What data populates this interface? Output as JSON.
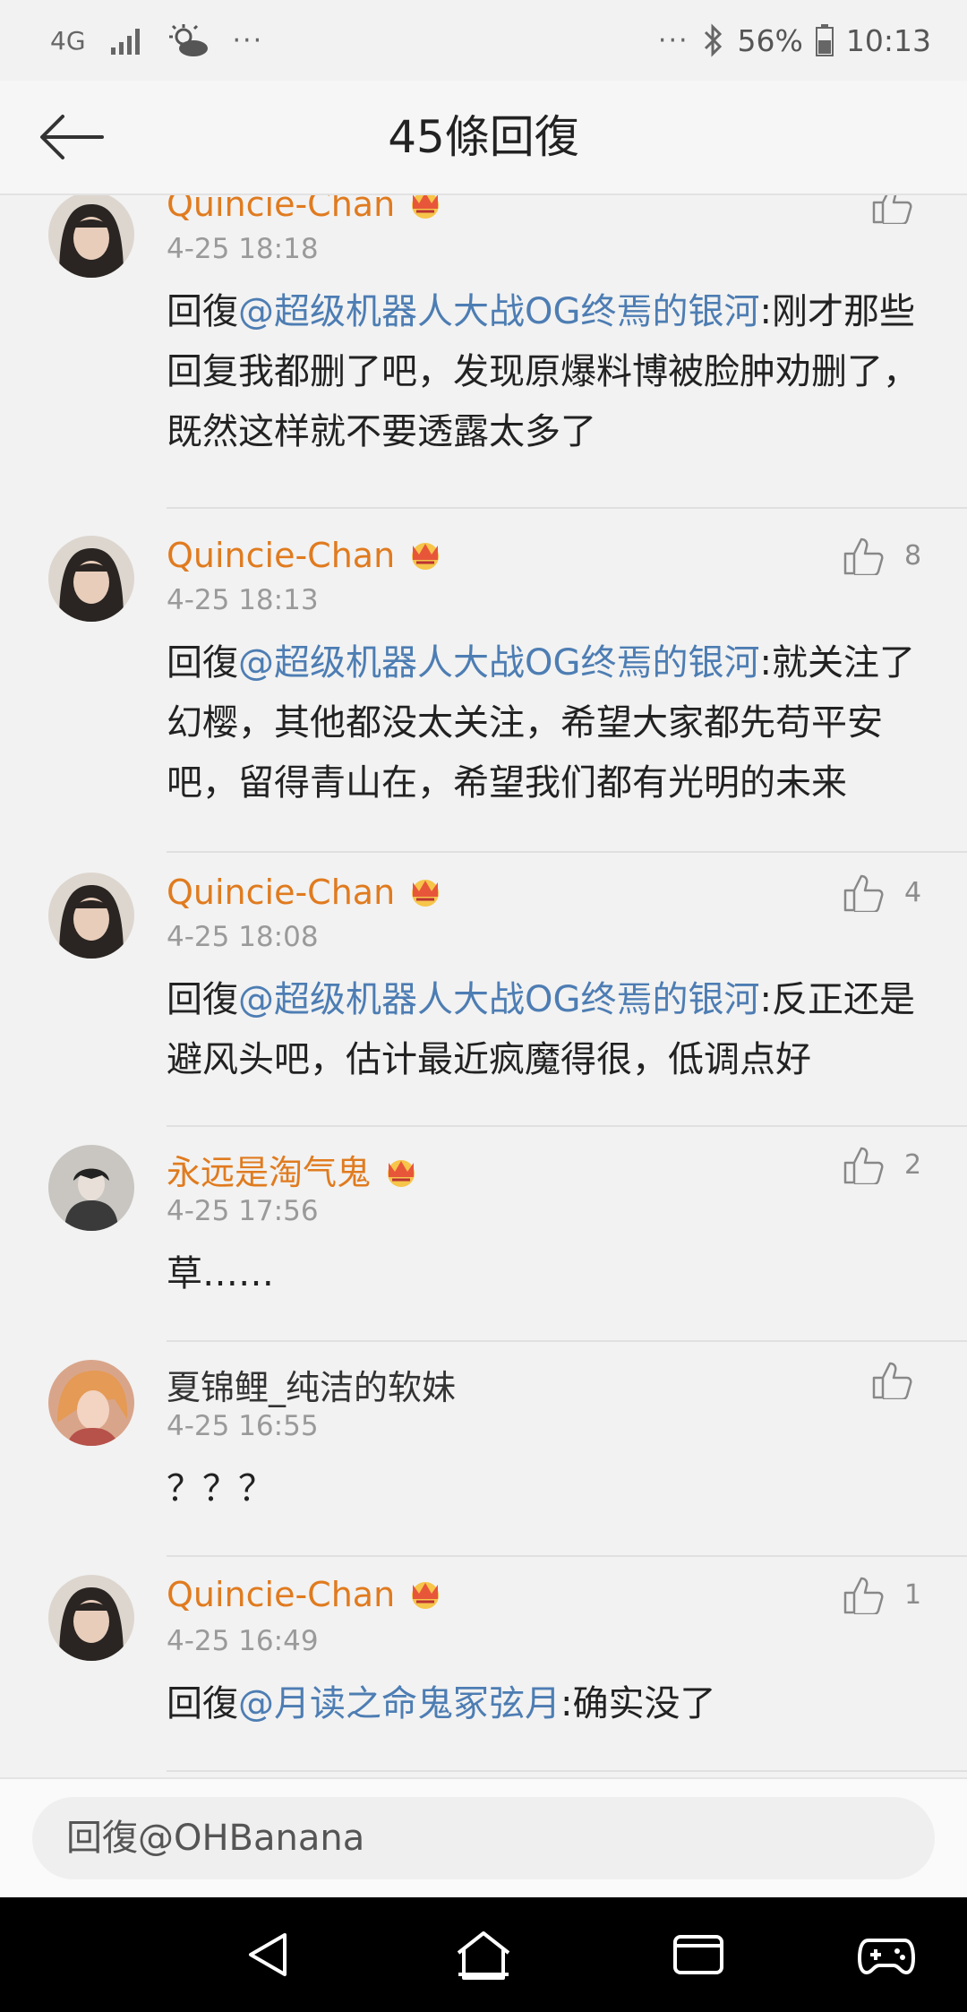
{
  "status_bar": {
    "network": "4G",
    "more_left": "···",
    "more_right": "···",
    "battery": "56%",
    "time": "10:13"
  },
  "header": {
    "title": "45條回復"
  },
  "comments": [
    {
      "username": "Quincie-Chan",
      "vip": true,
      "time": "4-25 18:18",
      "likes": "",
      "prefix": "回復",
      "mention": "@超级机器人大战OG终焉的银河",
      "text": ":刚才那些回复我都删了吧，发现原爆料博被脸肿劝删了，既然这样就不要透露太多了"
    },
    {
      "username": "Quincie-Chan",
      "vip": true,
      "time": "4-25 18:13",
      "likes": "8",
      "prefix": "回復",
      "mention": "@超级机器人大战OG终焉的银河",
      "text": ":就关注了幻樱，其他都没太关注，希望大家都先苟平安吧，留得青山在，希望我们都有光明的未来"
    },
    {
      "username": "Quincie-Chan",
      "vip": true,
      "time": "4-25 18:08",
      "likes": "4",
      "prefix": "回復",
      "mention": "@超级机器人大战OG终焉的银河",
      "text": ":反正还是避风头吧，估计最近疯魔得很，低调点好"
    },
    {
      "username": "永远是淘气鬼",
      "vip": true,
      "time": "4-25 17:56",
      "likes": "2",
      "prefix": "",
      "mention": "",
      "text": "草……"
    },
    {
      "username": "夏锦鲤_纯洁的软妹",
      "vip": false,
      "time": "4-25 16:55",
      "likes": "",
      "prefix": "",
      "mention": "",
      "text": "？？？"
    },
    {
      "username": "Quincie-Chan",
      "vip": true,
      "time": "4-25 16:49",
      "likes": "1",
      "prefix": "回復",
      "mention": "@月读之命鬼冢弦月",
      "text": ":确实没了"
    }
  ],
  "reply_bar": {
    "placeholder": "回復@OHBanana"
  },
  "colors": {
    "username": "#e07b1f",
    "mention": "#4d7db3",
    "timestamp": "#9a9a9a"
  },
  "icons": [
    "back-arrow-icon",
    "crown-icon",
    "thumbs-up-icon",
    "nav-back-icon",
    "nav-home-icon",
    "nav-recents-icon",
    "game-controller-icon"
  ]
}
